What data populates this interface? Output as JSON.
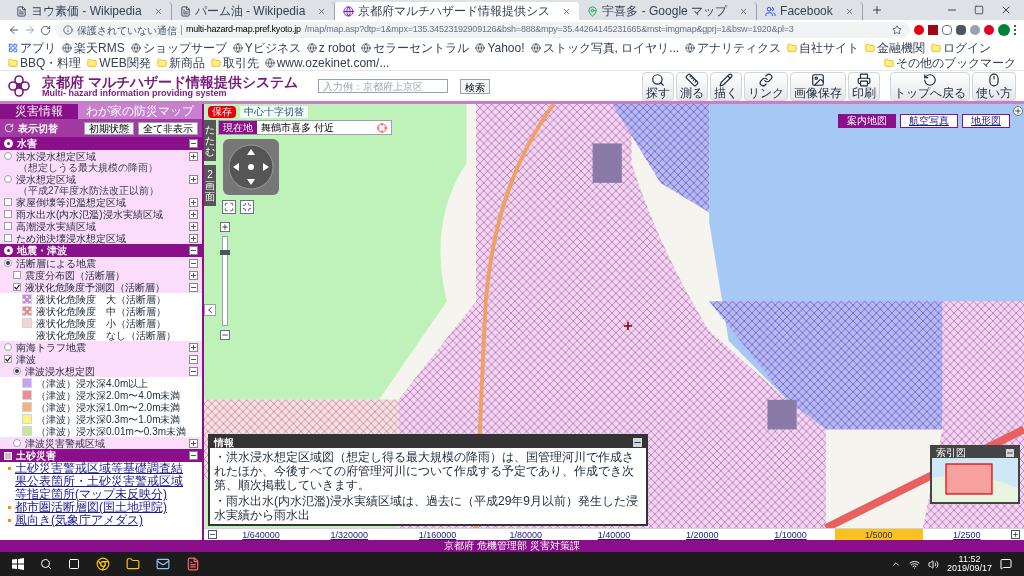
{
  "browser": {
    "tabs": [
      {
        "title": "ヨウ素価 - Wikipedia",
        "kind": "wiki",
        "selected": false
      },
      {
        "title": "パーム油 - Wikipedia",
        "kind": "wiki",
        "selected": false
      },
      {
        "title": "京都府マルチハザード情報提供シス",
        "kind": "site",
        "selected": true
      },
      {
        "title": "宇喜多 - Google マップ",
        "kind": "maps",
        "selected": false
      },
      {
        "title": "Facebook",
        "kind": "social",
        "selected": false
      }
    ],
    "address": {
      "security": "保護されていない通信",
      "host": "multi-hazard-map.pref.kyoto.jp",
      "path": "/map/map.asp?dtp=1&mpx=135.34523192909126&bsh=888&mpy=35.44264145231665&mst=imgmap&gprj=1&bsw=1920&pl=3"
    },
    "bookmarks": [
      {
        "label": "アプリ",
        "kind": "apps"
      },
      {
        "label": "楽天RMS",
        "kind": "site"
      },
      {
        "label": "ショップサーブ",
        "kind": "site"
      },
      {
        "label": "Yビジネス",
        "kind": "site"
      },
      {
        "label": "z robot",
        "kind": "site"
      },
      {
        "label": "セラーセントラル",
        "kind": "site"
      },
      {
        "label": "Yahoo!",
        "kind": "site"
      },
      {
        "label": "ストック写真, ロイヤリ...",
        "kind": "site"
      },
      {
        "label": "アナリティクス",
        "kind": "site"
      },
      {
        "label": "自社サイト",
        "kind": "folder"
      },
      {
        "label": "金融機関",
        "kind": "folder"
      },
      {
        "label": "ログイン",
        "kind": "folder"
      },
      {
        "label": "BBQ・料理",
        "kind": "folder"
      },
      {
        "label": "WEB関発",
        "kind": "folder"
      },
      {
        "label": "新商品",
        "kind": "folder"
      },
      {
        "label": "取引先",
        "kind": "folder"
      },
      {
        "label": "www.ozekinet.com/...",
        "kind": "site"
      }
    ],
    "other_bookmarks": "その他のブックマーク"
  },
  "header": {
    "title": "京都府 マルチハザード情報提供システム",
    "subtitle": "Multi- hazard information providing system",
    "search": {
      "placeholder": "入力例：京都府上京区"
    },
    "search_button": "検索",
    "tools": [
      {
        "label": "探す",
        "kind": "search"
      },
      {
        "label": "測る",
        "kind": "measure"
      },
      {
        "label": "描く",
        "kind": "draw"
      },
      {
        "label": "リンク",
        "kind": "link"
      },
      {
        "label": "画像保存",
        "kind": "save"
      },
      {
        "label": "印刷",
        "kind": "print"
      },
      {
        "label": "トップへ戻る",
        "kind": "top"
      },
      {
        "label": "使い方",
        "kind": "help"
      }
    ]
  },
  "sidebar": {
    "tabs": [
      {
        "label": "災害情報",
        "selected": true
      },
      {
        "label": "わが家の防災マップ",
        "selected": false
      }
    ],
    "toggle_label": "表示切替",
    "buttons": [
      "初期状態",
      "全て非表示"
    ],
    "tree": [
      {
        "kind": "section",
        "label": "水害",
        "selected": true,
        "expanded": true,
        "children": [
          {
            "kind": "radio",
            "label": "洪水浸水想定区域",
            "note": "（想定しうる最大規模の降雨）",
            "selected": false,
            "expanded": false
          },
          {
            "kind": "radio",
            "label": "浸水想定区域",
            "note": "（平成27年度水防法改正以前）",
            "selected": false,
            "expanded": false
          },
          {
            "kind": "checkbox",
            "label": "家屋倒壊等氾濫想定区域",
            "checked": false,
            "expanded": false
          },
          {
            "kind": "checkbox",
            "label": "雨水出水(内水氾濫)浸水実績区域",
            "checked": false,
            "expanded": false
          },
          {
            "kind": "checkbox",
            "label": "高潮浸水実績区域",
            "checked": false,
            "expanded": false
          },
          {
            "kind": "checkbox",
            "label": "ため池決壊浸水想定区域",
            "checked": false,
            "expanded": false
          }
        ]
      },
      {
        "kind": "section",
        "label": "地震・津波",
        "selected": true,
        "expanded": true,
        "children": [
          {
            "kind": "radio",
            "label": "活断層による地震",
            "selected": true,
            "expanded": true,
            "children": [
              {
                "kind": "checkbox",
                "label": "震度分布図（活断層）",
                "checked": false,
                "expanded": false
              },
              {
                "kind": "checkbox",
                "label": "液状化危険度予測図（活断層）",
                "checked": true,
                "expanded": true,
                "children": [
                  {
                    "kind": "legend",
                    "label": "液状化危険度　大（活断層）",
                    "color": "#c98ae6",
                    "hatched": true
                  },
                  {
                    "kind": "legend",
                    "label": "液状化危険度　中（活断層）",
                    "color": "#f08a8a",
                    "hatched": true
                  },
                  {
                    "kind": "legend",
                    "label": "液状化危険度　小（活断層）",
                    "color": "#f6d5c8",
                    "hatched": false
                  },
                  {
                    "kind": "legend",
                    "label": "液状化危険度　なし（活断層）"
                  }
                ]
              }
            ]
          },
          {
            "kind": "radio",
            "label": "南海トラフ地震",
            "selected": false,
            "expanded": false
          },
          {
            "kind": "checkbox",
            "label": "津波",
            "checked": true,
            "expanded": true,
            "children": [
              {
                "kind": "radio",
                "label": "津波浸水想定図",
                "selected": true,
                "expanded": true,
                "children": [
                  {
                    "kind": "legend",
                    "label": "（津波）浸水深4.0m以上",
                    "color": "#c9a0f5",
                    "hatched": false
                  },
                  {
                    "kind": "legend",
                    "label": "（津波）浸水深2.0m〜4.0m未満",
                    "color": "#f28a94",
                    "hatched": false
                  },
                  {
                    "kind": "legend",
                    "label": "（津波）浸水深1.0m〜2.0m未満",
                    "color": "#f7b27a",
                    "hatched": false
                  },
                  {
                    "kind": "legend",
                    "label": "（津波）浸水深0.3m〜1.0m未満",
                    "color": "#fdf37a",
                    "hatched": false
                  },
                  {
                    "kind": "legend",
                    "label": "（津波）浸水深0.01m〜0.3m未満",
                    "color": "#c8e59a",
                    "hatched": false
                  }
                ]
              },
              {
                "kind": "radio",
                "label": "津波災害警戒区域",
                "selected": false,
                "expanded": false
              }
            ]
          }
        ]
      },
      {
        "kind": "section-check",
        "label": "土砂災害",
        "checked": false,
        "expanded": true,
        "children": [
          {
            "kind": "link",
            "label": "土砂災害警戒区域等基礎調査結果公表箇所・土砂災害警戒区域等指定箇所(マップ未反映分)"
          },
          {
            "kind": "link",
            "label": "都市圏活断層図(国土地理院)"
          },
          {
            "kind": "link",
            "label": "風向き(気象庁アメダス)"
          }
        ]
      }
    ]
  },
  "map": {
    "crosshair_toggle": "中心十字切替",
    "save_badge": "保存",
    "location_label": "現在地",
    "location": "舞鶴市喜多 付近",
    "collapse_label": "たたむ",
    "split_label": "2画面",
    "zoom_slider": {
      "level": 0.85
    },
    "map_types": [
      {
        "label": "案内地図",
        "selected": true
      },
      {
        "label": "航空写真",
        "selected": false
      },
      {
        "label": "地形図",
        "selected": false
      }
    ],
    "info": {
      "title": "情報",
      "paragraphs": [
        "・洪水浸水想定区域図（想定し得る最大規模の降雨）は、国管理河川で作成されたほか、今後すべての府管理河川について作成する予定であり、作成でき次第、順次掲載していきます。",
        "・雨水出水(内水氾濫)浸水実績区域は、過去に（平成29年9月以前）発生した浸水実績から雨水出"
      ]
    },
    "overview_title": "索引図"
  },
  "scales": [
    {
      "label": "1/640000",
      "selected": false
    },
    {
      "label": "1/320000",
      "selected": false
    },
    {
      "label": "1/160000",
      "selected": false
    },
    {
      "label": "1/80000",
      "selected": false
    },
    {
      "label": "1/40000",
      "selected": false
    },
    {
      "label": "1/20000",
      "selected": false
    },
    {
      "label": "1/10000",
      "selected": false
    },
    {
      "label": "1/5000",
      "selected": true
    },
    {
      "label": "1/2500",
      "selected": false
    }
  ],
  "footer": "京都府 危機管理部 災害対策課",
  "taskbar": {
    "time": "11:52",
    "date": "2019/09/17"
  }
}
